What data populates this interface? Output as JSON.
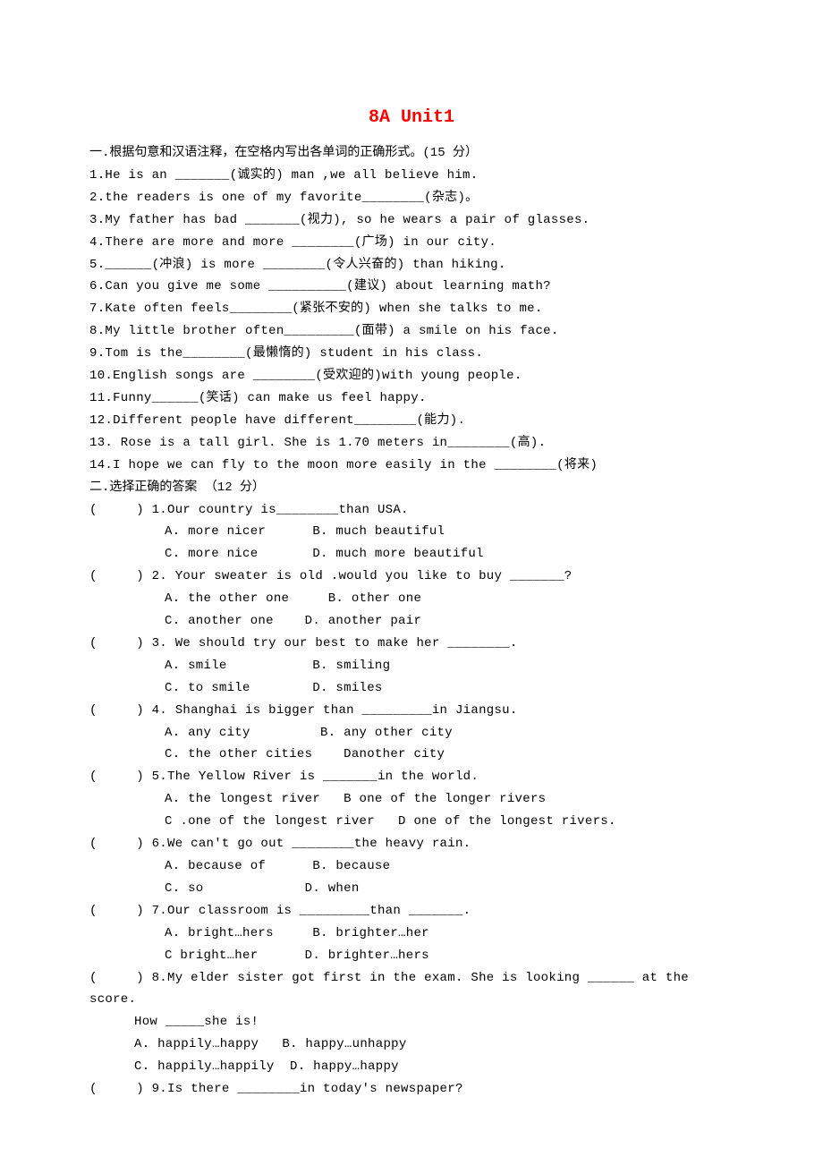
{
  "title": "8A Unit1",
  "section1": {
    "header": "一.根据句意和汉语注释，在空格内写出各单词的正确形式。(15 分）",
    "items": [
      "1.He is an _______(诚实的) man ,we all believe him.",
      "2.the readers is one of my favorite________(杂志)。",
      "3.My father has bad _______(视力), so he wears a pair of glasses.",
      "4.There are more and more ________(广场) in our city.",
      "5.______(冲浪) is more ________(令人兴奋的) than hiking.",
      "6.Can you give me some __________(建议) about learning math?",
      "7.Kate often feels________(紧张不安的) when she talks to me.",
      "8.My little brother often_________(面带) a smile on his face.",
      "9.Tom is the________(最懒惰的) student in his class.",
      "10.English songs are ________(受欢迎的)with young people.",
      "11.Funny______(笑话) can make us feel happy.",
      "12.Different people have different________(能力).",
      "13. Rose is a tall girl. She is 1.70 meters in________(高).",
      "14.I hope we can fly to the moon more easily in the ________(将来)"
    ]
  },
  "section2": {
    "header": "二.选择正确的答案 （12 分）",
    "questions": [
      {
        "q": "(     ) 1.Our country is________than USA.",
        "opts": [
          "A. more nicer      B. much beautiful",
          "C. more nice       D. much more beautiful"
        ]
      },
      {
        "q": "(     ) 2. Your sweater is old .would you like to buy _______?",
        "opts": [
          "A. the other one     B. other one",
          "C. another one    D. another pair"
        ]
      },
      {
        "q": "(     ) 3. We should try our best to make her ________.",
        "opts": [
          "A. smile           B. smiling",
          "C. to smile        D. smiles"
        ]
      },
      {
        "q": "(     ) 4. Shanghai is bigger than _________in Jiangsu.",
        "opts": [
          "A. any city         B. any other city",
          "C. the other cities    Danother city"
        ]
      },
      {
        "q": "(     ) 5.The Yellow River is _______in the world.",
        "opts": [
          "A. the longest river   B one of the longer rivers",
          "C .one of the longest river   D one of the longest rivers."
        ]
      },
      {
        "q": "(     ) 6.We can't go out ________the heavy rain.",
        "opts": [
          "A. because of      B. because",
          "C. so             D. when"
        ]
      },
      {
        "q": "(     ) 7.Our classroom is _________than _______.",
        "opts": [
          "A. bright…hers     B. brighter…her",
          "C bright…her      D. brighter…hers"
        ]
      },
      {
        "q": "(     ) 8.My elder sister got first in the exam. She is looking ______ at the score.",
        "opts": [
          "How _____she is!",
          "A. happily…happy   B. happy…unhappy",
          "C. happily…happily  D. happy…happy"
        ],
        "optIndent": "indent2"
      },
      {
        "q": "(     ) 9.Is there ________in today's newspaper?",
        "opts": []
      }
    ]
  }
}
